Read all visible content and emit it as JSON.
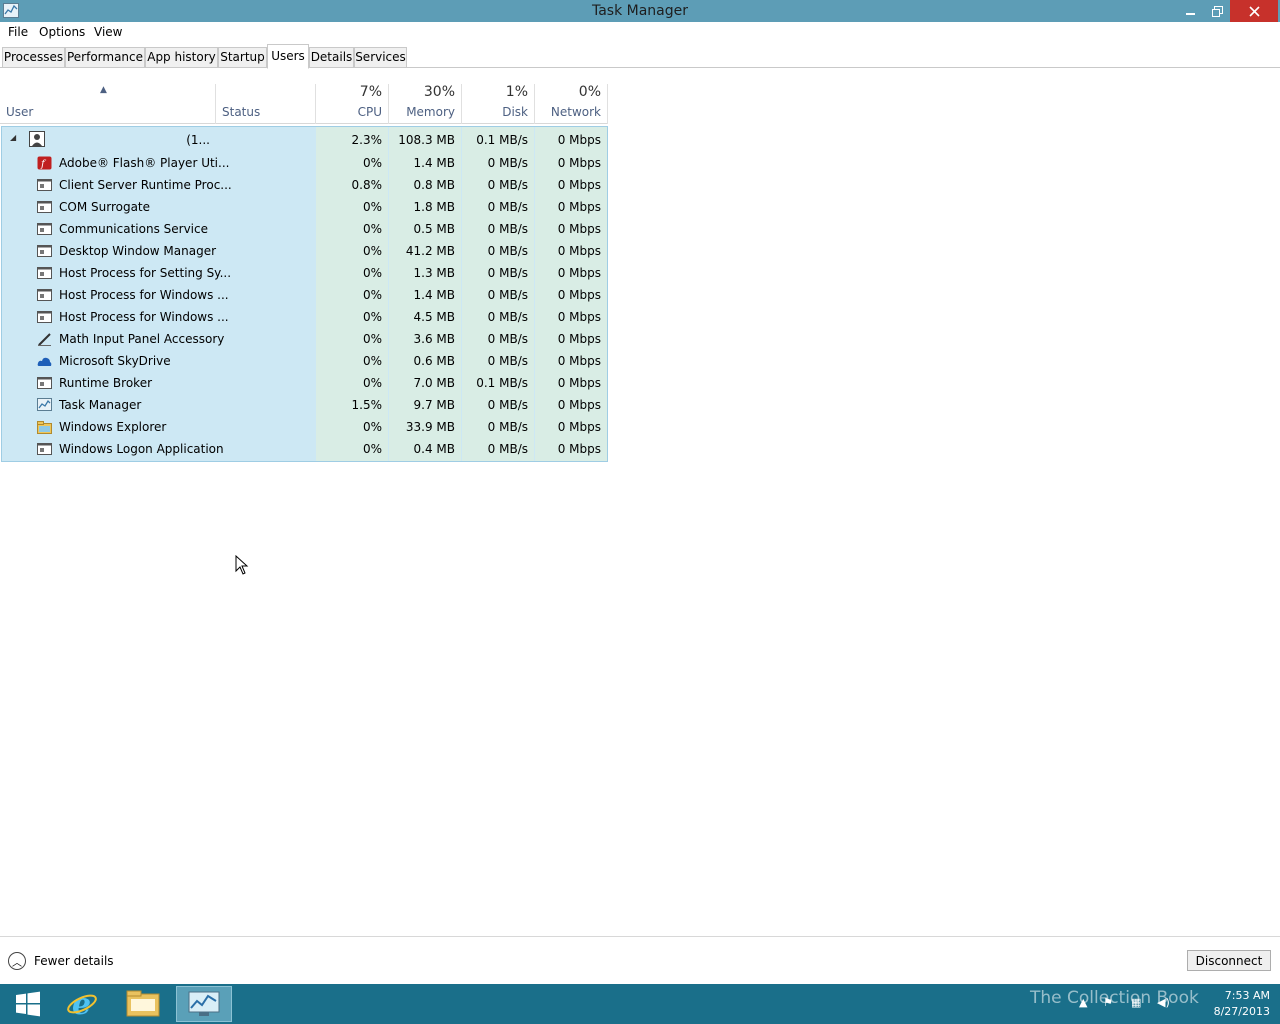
{
  "window": {
    "title": "Task Manager"
  },
  "menu": [
    "File",
    "Options",
    "View"
  ],
  "tabs": [
    "Processes",
    "Performance",
    "App history",
    "Startup",
    "Users",
    "Details",
    "Services"
  ],
  "active_tab": "Users",
  "columns": {
    "user": "User",
    "status": "Status",
    "cpu": {
      "pct": "7%",
      "label": "CPU"
    },
    "memory": {
      "pct": "30%",
      "label": "Memory"
    },
    "disk": {
      "pct": "1%",
      "label": "Disk"
    },
    "network": {
      "pct": "0%",
      "label": "Network"
    }
  },
  "user_row": {
    "name": "(1...",
    "cpu": "2.3%",
    "memory": "108.3 MB",
    "disk": "0.1 MB/s",
    "network": "0 Mbps"
  },
  "processes": [
    {
      "name": "Adobe® Flash® Player Uti...",
      "icon": "flash-icon",
      "cpu": "0%",
      "memory": "1.4 MB",
      "disk": "0 MB/s",
      "network": "0 Mbps"
    },
    {
      "name": "Client Server Runtime Proc...",
      "icon": "window-icon",
      "cpu": "0.8%",
      "memory": "0.8 MB",
      "disk": "0 MB/s",
      "network": "0 Mbps"
    },
    {
      "name": "COM Surrogate",
      "icon": "window-icon",
      "cpu": "0%",
      "memory": "1.8 MB",
      "disk": "0 MB/s",
      "network": "0 Mbps"
    },
    {
      "name": "Communications Service",
      "icon": "window-icon",
      "cpu": "0%",
      "memory": "0.5 MB",
      "disk": "0 MB/s",
      "network": "0 Mbps"
    },
    {
      "name": "Desktop Window Manager",
      "icon": "window-icon",
      "cpu": "0%",
      "memory": "41.2 MB",
      "disk": "0 MB/s",
      "network": "0 Mbps"
    },
    {
      "name": "Host Process for Setting Sy...",
      "icon": "window-icon",
      "cpu": "0%",
      "memory": "1.3 MB",
      "disk": "0 MB/s",
      "network": "0 Mbps"
    },
    {
      "name": "Host Process for Windows ...",
      "icon": "window-icon",
      "cpu": "0%",
      "memory": "1.4 MB",
      "disk": "0 MB/s",
      "network": "0 Mbps"
    },
    {
      "name": "Host Process for Windows ...",
      "icon": "window-icon",
      "cpu": "0%",
      "memory": "4.5 MB",
      "disk": "0 MB/s",
      "network": "0 Mbps"
    },
    {
      "name": "Math Input Panel Accessory",
      "icon": "pen-icon",
      "cpu": "0%",
      "memory": "3.6 MB",
      "disk": "0 MB/s",
      "network": "0 Mbps"
    },
    {
      "name": "Microsoft SkyDrive",
      "icon": "cloud-icon",
      "cpu": "0%",
      "memory": "0.6 MB",
      "disk": "0 MB/s",
      "network": "0 Mbps"
    },
    {
      "name": "Runtime Broker",
      "icon": "window-icon",
      "cpu": "0%",
      "memory": "7.0 MB",
      "disk": "0.1 MB/s",
      "network": "0 Mbps"
    },
    {
      "name": "Task Manager",
      "icon": "taskmgr-icon",
      "cpu": "1.5%",
      "memory": "9.7 MB",
      "disk": "0 MB/s",
      "network": "0 Mbps"
    },
    {
      "name": "Windows Explorer",
      "icon": "folder-icon",
      "cpu": "0%",
      "memory": "33.9 MB",
      "disk": "0 MB/s",
      "network": "0 Mbps"
    },
    {
      "name": "Windows Logon Application",
      "icon": "window-icon",
      "cpu": "0%",
      "memory": "0.4 MB",
      "disk": "0 MB/s",
      "network": "0 Mbps"
    }
  ],
  "footer": {
    "fewer_details": "Fewer details",
    "disconnect": "Disconnect"
  },
  "taskbar": {
    "time": "7:53 AM",
    "date": "8/27/2013",
    "watermark": "The Collection Book"
  },
  "colors": {
    "title_bar": "#5d9db6",
    "selection": "#cde8f4",
    "taskbar": "#1a6f8a",
    "close_button": "#c7312b"
  }
}
